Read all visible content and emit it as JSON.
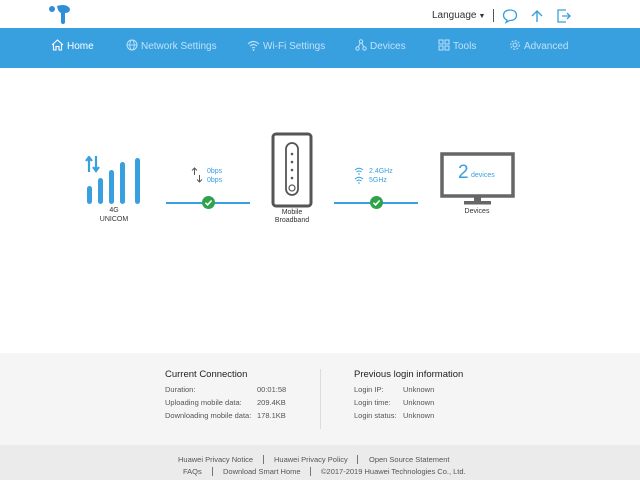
{
  "header": {
    "language_label": "Language",
    "icons": [
      "message-icon",
      "upload-icon",
      "logout-icon"
    ]
  },
  "nav": [
    {
      "label": "Home",
      "icon": "home-icon",
      "active": true
    },
    {
      "label": "Network Settings",
      "icon": "globe-icon",
      "active": false
    },
    {
      "label": "Wi-Fi Settings",
      "icon": "wifi-icon",
      "active": false
    },
    {
      "label": "Devices",
      "icon": "devices-icon",
      "active": false
    },
    {
      "label": "Tools",
      "icon": "tools-icon",
      "active": false
    },
    {
      "label": "Advanced",
      "icon": "gear-icon",
      "active": false
    }
  ],
  "status": {
    "network_type": "4G",
    "operator": "UNICOM",
    "upload_rate": "0bps",
    "download_rate": "0bps",
    "router_label_line1": "Mobile",
    "router_label_line2": "Broadband",
    "wifi_band_1": "2.4GHz",
    "wifi_band_2": "5GHz",
    "device_count": "2",
    "device_unit": "devices",
    "devices_label": "Devices"
  },
  "current_connection": {
    "title": "Current Connection",
    "rows": [
      {
        "label": "Duration:",
        "value": "00:01:58"
      },
      {
        "label": "Uploading mobile data:",
        "value": "209.4KB"
      },
      {
        "label": "Downloading mobile data:",
        "value": "178.1KB"
      }
    ]
  },
  "previous_login": {
    "title": "Previous login information",
    "rows": [
      {
        "label": "Login IP:",
        "value": "Unknown"
      },
      {
        "label": "Login time:",
        "value": "Unknown"
      },
      {
        "label": "Login status:",
        "value": "Unknown"
      }
    ]
  },
  "footer": {
    "links_row1": [
      "Huawei Privacy Notice",
      "Huawei Privacy Policy",
      "Open Source Statement"
    ],
    "links_row2": [
      "FAQs",
      "Download Smart Home"
    ],
    "copyright": "©2017-2019 Huawei Technologies Co., Ltd."
  },
  "colors": {
    "brand_blue": "#39a0e0",
    "nav_inactive": "#bfe2f7",
    "ok_green": "#2fa34a"
  }
}
